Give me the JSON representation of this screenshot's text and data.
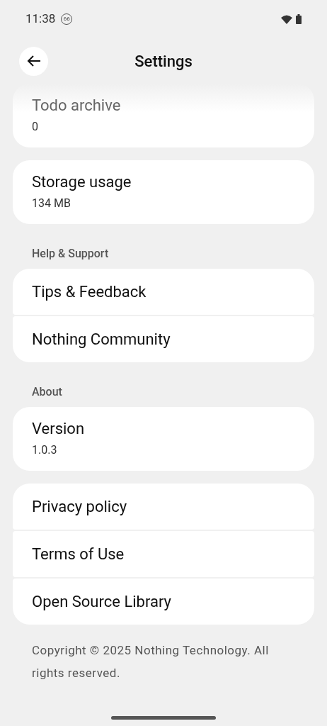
{
  "status_bar": {
    "time": "11:38",
    "badge": "66"
  },
  "header": {
    "title": "Settings"
  },
  "groups": [
    {
      "items": [
        {
          "title": "Todo archive",
          "subtitle": "0"
        }
      ]
    },
    {
      "items": [
        {
          "title": "Storage usage",
          "subtitle": "134 MB"
        }
      ]
    },
    {
      "heading": "Help & Support",
      "items": [
        {
          "title": "Tips & Feedback"
        },
        {
          "title": "Nothing Community"
        }
      ]
    },
    {
      "heading": "About",
      "items": [
        {
          "title": "Version",
          "subtitle": "1.0.3"
        }
      ]
    },
    {
      "items": [
        {
          "title": "Privacy policy"
        },
        {
          "title": "Terms of Use"
        },
        {
          "title": "Open Source Library"
        }
      ]
    }
  ],
  "footer": "Copyright © 2025 Nothing Technology. All rights reserved."
}
